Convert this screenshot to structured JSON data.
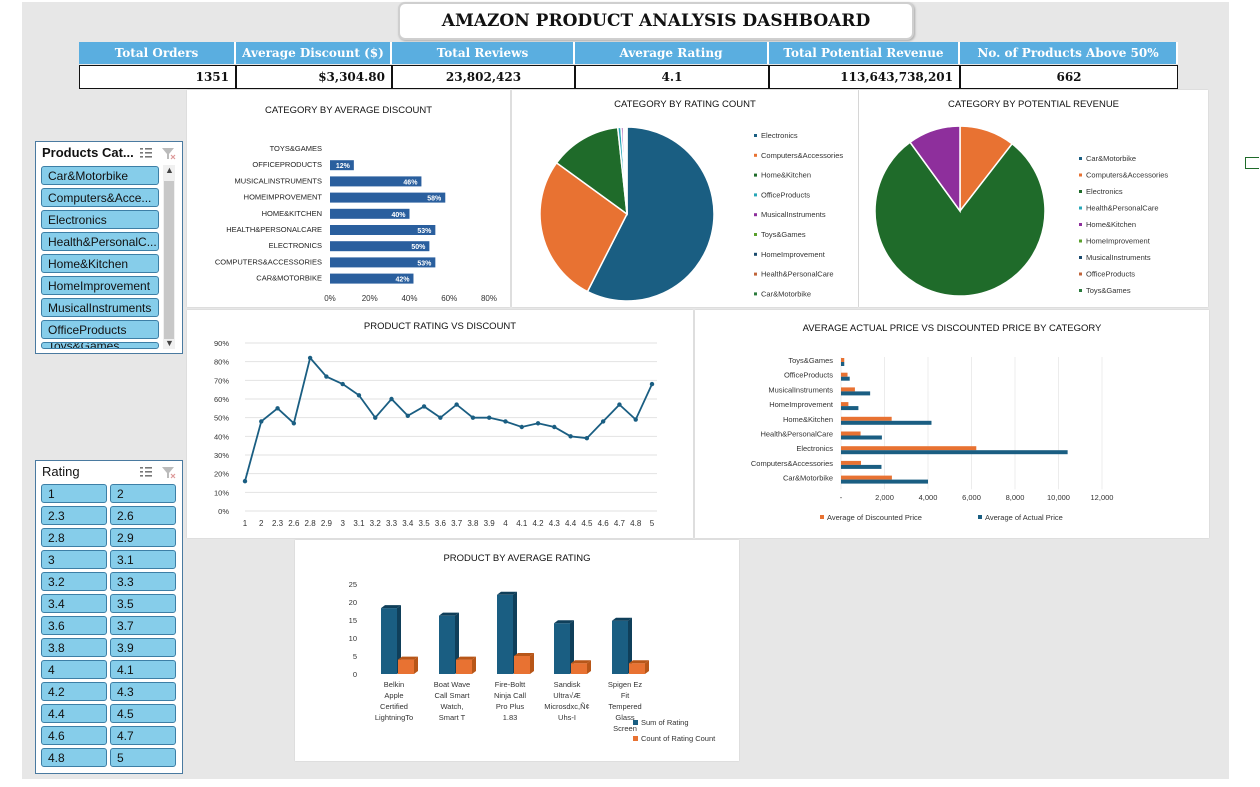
{
  "title": "AMAZON PRODUCT ANALYSIS DASHBOARD",
  "kpis": [
    {
      "label": "Total Orders",
      "value": "1351"
    },
    {
      "label": "Average Discount ($)",
      "value": "$3,304.80"
    },
    {
      "label": "Total Reviews",
      "value": "23,802,423"
    },
    {
      "label": "Average Rating",
      "value": "4.1"
    },
    {
      "label": "Total Potential Revenue",
      "value": "113,643,738,201"
    },
    {
      "label": "No. of Products Above 50%",
      "value": "662"
    }
  ],
  "slicer_category": {
    "title": "Products Cat...",
    "items": [
      "Car&Motorbike",
      "Computers&Acce...",
      "Electronics",
      "Health&PersonalC...",
      "Home&Kitchen",
      "HomeImprovement",
      "MusicalInstruments",
      "OfficeProducts",
      "Toys&Games"
    ]
  },
  "slicer_rating": {
    "title": "Rating",
    "items": [
      "1",
      "2",
      "2.3",
      "2.6",
      "2.8",
      "2.9",
      "3",
      "3.1",
      "3.2",
      "3.3",
      "3.4",
      "3.5",
      "3.6",
      "3.7",
      "3.8",
      "3.9",
      "4",
      "4.1",
      "4.2",
      "4.3",
      "4.4",
      "4.5",
      "4.6",
      "4.7",
      "4.8",
      "5"
    ]
  },
  "chart_data": [
    {
      "type": "bar",
      "title": "CATEGORY BY AVERAGE DISCOUNT",
      "orientation": "horizontal",
      "categories": [
        "TOYS&GAMES",
        "OFFICEPRODUCTS",
        "MUSICALINSTRUMENTS",
        "HOMEIMPROVEMENT",
        "HOME&KITCHEN",
        "HEALTH&PERSONALCARE",
        "ELECTRONICS",
        "COMPUTERS&ACCESSORIES",
        "CAR&MOTORBIKE"
      ],
      "values": [
        0,
        12,
        46,
        58,
        40,
        53,
        50,
        53,
        42
      ],
      "data_labels": [
        "",
        "12%",
        "46%",
        "58%",
        "40%",
        "53%",
        "50%",
        "53%",
        "42%"
      ],
      "xticks": [
        "0%",
        "20%",
        "40%",
        "60%",
        "80%"
      ],
      "xlim": [
        0,
        80
      ],
      "color": "#2a5f9e"
    },
    {
      "type": "pie",
      "title": "CATEGORY BY RATING COUNT",
      "labels": [
        "Electronics",
        "Computers&Accessories",
        "Home&Kitchen",
        "OfficeProducts",
        "MusicalInstruments",
        "Toys&Games",
        "HomeImprovement",
        "Health&PersonalCare",
        "Car&Motorbike"
      ],
      "values": [
        57.5,
        27.5,
        13.3,
        0.6,
        0.4,
        0.3,
        0.2,
        0.2,
        0.0
      ],
      "colors": [
        "#1a5e82",
        "#e87232",
        "#1f6b2a",
        "#27a7b8",
        "#8e2f9c",
        "#5aa02c",
        "#1a4a6e",
        "#c0643a",
        "#2a7a3c"
      ],
      "legend_position": "right"
    },
    {
      "type": "pie",
      "title": "CATEGORY BY POTENTIAL REVENUE",
      "labels": [
        "Car&Motorbike",
        "Computers&Accessories",
        "Electronics",
        "Health&PersonalCare",
        "Home&Kitchen",
        "HomeImprovement",
        "MusicalInstruments",
        "OfficeProducts",
        "Toys&Games"
      ],
      "values": [
        0,
        10.5,
        79.5,
        0,
        10,
        0,
        0,
        0,
        0
      ],
      "colors": [
        "#1a5e82",
        "#e87232",
        "#1f6b2a",
        "#27a7b8",
        "#8e2f9c",
        "#5aa02c",
        "#1a4a6e",
        "#c0643a",
        "#2a7a3c"
      ],
      "legend_position": "right"
    },
    {
      "type": "line",
      "title": "PRODUCT RATING VS DISCOUNT",
      "x": [
        "1",
        "2",
        "2.3",
        "2.6",
        "2.8",
        "2.9",
        "3",
        "3.1",
        "3.2",
        "3.3",
        "3.4",
        "3.5",
        "3.6",
        "3.7",
        "3.8",
        "3.9",
        "4",
        "4.1",
        "4.2",
        "4.3",
        "4.4",
        "4.5",
        "4.6",
        "4.7",
        "4.8",
        "5"
      ],
      "y": [
        16,
        48,
        55,
        47,
        82,
        72,
        68,
        62,
        50,
        60,
        51,
        56,
        50,
        57,
        50,
        50,
        48,
        45,
        47,
        45,
        40,
        39,
        48,
        57,
        49,
        68
      ],
      "ylim": [
        0,
        90
      ],
      "yticks": [
        "0%",
        "10%",
        "20%",
        "30%",
        "40%",
        "50%",
        "60%",
        "70%",
        "80%",
        "90%"
      ],
      "color": "#1a5e82"
    },
    {
      "type": "bar",
      "title": "AVERAGE ACTUAL PRICE VS DISCOUNTED PRICE BY CATEGORY",
      "orientation": "horizontal",
      "categories": [
        "Toys&Games",
        "OfficeProducts",
        "MusicalInstruments",
        "HomeImprovement",
        "Home&Kitchen",
        "Health&PersonalCare",
        "Electronics",
        "Computers&Accessories",
        "Car&Motorbike"
      ],
      "series": [
        {
          "name": "Average of Discounted Price",
          "values": [
            150,
            300,
            640,
            340,
            2330,
            900,
            6220,
            920,
            2340
          ],
          "color": "#e87232"
        },
        {
          "name": "Average of Actual Price",
          "values": [
            150,
            400,
            1340,
            800,
            4160,
            1880,
            10420,
            1860,
            4000
          ],
          "color": "#1a5e82"
        }
      ],
      "xticks": [
        "-",
        "2,000",
        "4,000",
        "6,000",
        "8,000",
        "10,000",
        "12,000"
      ],
      "xlim": [
        0,
        12000
      ]
    },
    {
      "type": "bar",
      "title": "PRODUCT BY AVERAGE RATING",
      "categories": [
        "Belkin Apple Certified LightningTo",
        "Boat Wave Call Smart Watch, Smart T",
        "Fire-Boltt Ninja Call Pro Plus 1.83",
        "Sandisk Ultra√Æ Microsdxc,Ñ¢ Uhs-I",
        "Spigen Ez Fit Tempered Glass Screen"
      ],
      "series": [
        {
          "name": "Sum of Rating",
          "values": [
            18.3,
            16.2,
            22.0,
            14.1,
            14.8
          ],
          "color": "#1a5e82"
        },
        {
          "name": "Count of Rating Count",
          "values": [
            4,
            4,
            5,
            3,
            3
          ],
          "color": "#e87232"
        }
      ],
      "yticks": [
        "0",
        "5",
        "10",
        "15",
        "20",
        "25"
      ],
      "ylim": [
        0,
        25
      ]
    }
  ]
}
